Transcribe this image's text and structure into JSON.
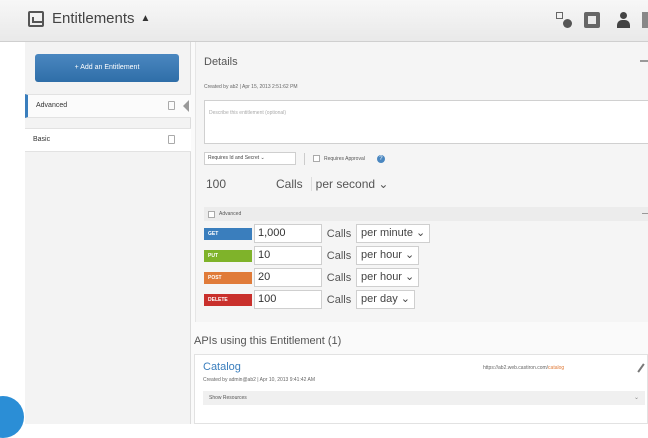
{
  "header": {
    "title": "Entitlements",
    "caret": "▲",
    "icons": [
      "settings-icon",
      "square-icon",
      "user-icon"
    ]
  },
  "sidebar": {
    "add_button": "+ Add an Entitlement",
    "items": [
      {
        "label": "Advanced",
        "active": true
      },
      {
        "label": "Basic",
        "active": false
      }
    ]
  },
  "details": {
    "title": "Details",
    "created": "Created by ab2  |  Apr 15, 2013 2:51:62 PM",
    "description_placeholder": "Describe this entitlement (optional)",
    "auth_select": "Requires Id and Secret ⌄",
    "requires_approval": "Requires Approval",
    "rate": {
      "value": "100",
      "calls": "Calls",
      "period": "per second ⌄"
    },
    "advanced_label": "Advanced",
    "verbs": [
      {
        "verb": "GET",
        "color": "#3a7ebd",
        "value": "1,000",
        "calls": "Calls",
        "period": "per minute ⌄"
      },
      {
        "verb": "PUT",
        "color": "#7fb32a",
        "value": "10",
        "calls": "Calls",
        "period": "per hour ⌄"
      },
      {
        "verb": "POST",
        "color": "#e07b39",
        "value": "20",
        "calls": "Calls",
        "period": "per hour ⌄"
      },
      {
        "verb": "DELETE",
        "color": "#c9302c",
        "value": "100",
        "calls": "Calls",
        "period": "per day ⌄"
      }
    ]
  },
  "apis": {
    "title": "APIs using this Entitlement (1)",
    "items": [
      {
        "name": "Catalog",
        "meta": "Created by admin@ab2  |  Apr 10, 2013 9:41:42 AM",
        "url_prefix": "https://ab2.web.castiron.com/",
        "url_path": "catalog",
        "show_resources": "Show Resources"
      }
    ]
  }
}
